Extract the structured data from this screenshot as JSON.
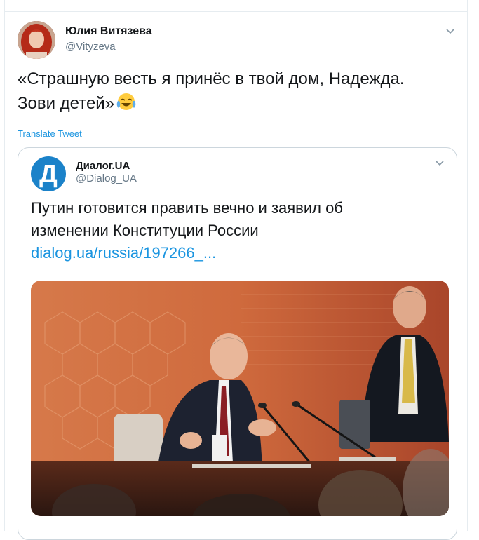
{
  "tweet": {
    "author_name": "Юлия Витязева",
    "author_handle": "@Vityzeva",
    "text": "«Страшную весть я принёс в твой дом, Надежда.\nЗови детей»",
    "emoji": "face-with-tears-of-joy",
    "translate_label": "Translate Tweet"
  },
  "quoted_tweet": {
    "author_name": "Диалог.UA",
    "author_handle": "@Dialog_UA",
    "logo_letter": "Д",
    "text": "Путин готовится править вечно и заявил об изменении Конституции России",
    "link": "dialog.ua/russia/197266_..."
  },
  "colors": {
    "accent": "#1b95e0",
    "muted": "#657786",
    "logo_blue": "#1b82c9"
  }
}
